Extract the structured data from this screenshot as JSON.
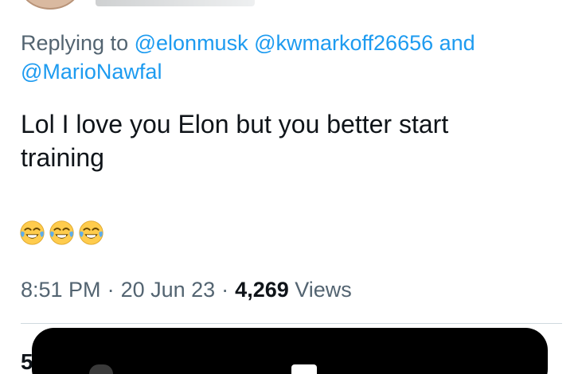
{
  "reply": {
    "prefix": "Replying to",
    "mentions": [
      "@elonmusk",
      "@kwmarkoff26656",
      "@MarioNawfal"
    ],
    "and": "and"
  },
  "tweet": {
    "text_line1": "Lol I love you Elon but you better start",
    "text_line2": "training",
    "emoji_icons": [
      "face-with-tears-of-joy-icon",
      "face-with-tears-of-joy-icon",
      "face-with-tears-of-joy-icon"
    ]
  },
  "meta": {
    "time": "8:51 PM",
    "date": "20 Jun 23",
    "separator": "·",
    "views_count": "4,269",
    "views_label": "Views"
  },
  "stats": {
    "first_digit": "5"
  },
  "colors": {
    "text": "#0f1419",
    "muted": "#536471",
    "link": "#1d9bf0",
    "divider": "#cfd9de"
  }
}
